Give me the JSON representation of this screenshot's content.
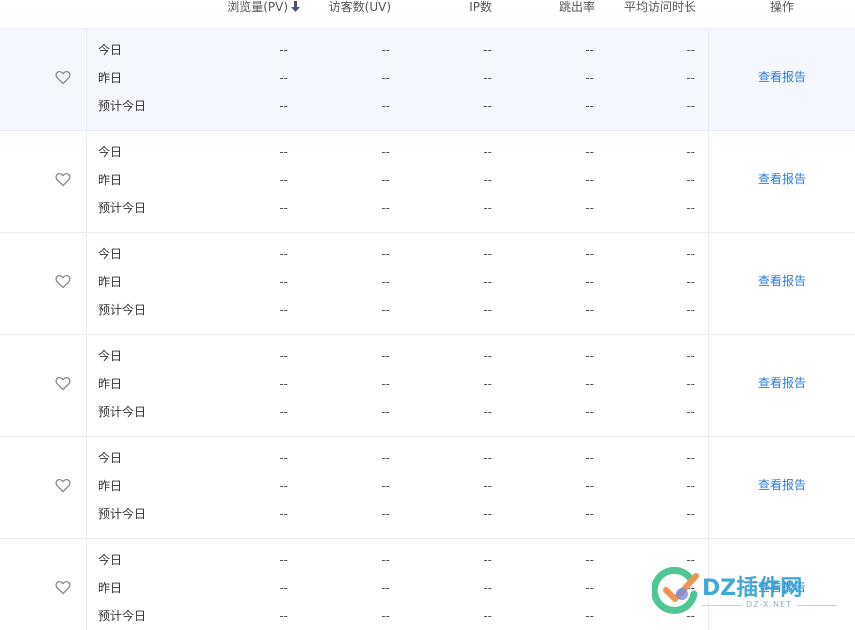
{
  "table": {
    "columns": {
      "pv": "浏览量(PV)",
      "uv": "访客数(UV)",
      "ip": "IP数",
      "bounce": "跳出率",
      "avg_time": "平均访问时长",
      "action": "操作"
    },
    "sort_icon": "arrow-down-icon",
    "row_labels": [
      "今日",
      "昨日",
      "预计今日"
    ],
    "empty_value": "--",
    "action_label": "查看报告",
    "favorite_icon": "heart-outline-icon",
    "groups": [
      {
        "highlighted": true,
        "rows": [
          [
            "--",
            "--",
            "--",
            "--",
            "--"
          ],
          [
            "--",
            "--",
            "--",
            "--",
            "--"
          ],
          [
            "--",
            "--",
            "--",
            "--",
            "--"
          ]
        ]
      },
      {
        "highlighted": false,
        "rows": [
          [
            "--",
            "--",
            "--",
            "--",
            "--"
          ],
          [
            "--",
            "--",
            "--",
            "--",
            "--"
          ],
          [
            "--",
            "--",
            "--",
            "--",
            "--"
          ]
        ]
      },
      {
        "highlighted": false,
        "rows": [
          [
            "--",
            "--",
            "--",
            "--",
            "--"
          ],
          [
            "--",
            "--",
            "--",
            "--",
            "--"
          ],
          [
            "--",
            "--",
            "--",
            "--",
            "--"
          ]
        ]
      },
      {
        "highlighted": false,
        "rows": [
          [
            "--",
            "--",
            "--",
            "--",
            "--"
          ],
          [
            "--",
            "--",
            "--",
            "--",
            "--"
          ],
          [
            "--",
            "--",
            "--",
            "--",
            "--"
          ]
        ]
      },
      {
        "highlighted": false,
        "rows": [
          [
            "--",
            "--",
            "--",
            "--",
            "--"
          ],
          [
            "--",
            "--",
            "--",
            "--",
            "--"
          ],
          [
            "--",
            "--",
            "--",
            "--",
            "--"
          ]
        ]
      },
      {
        "highlighted": false,
        "rows": [
          [
            "--",
            "--",
            "--",
            "--",
            "--"
          ],
          [
            "--",
            "--",
            "--",
            "--",
            "--"
          ],
          [
            "--",
            "--",
            "--",
            "--",
            "--"
          ]
        ]
      }
    ]
  },
  "watermark": {
    "text": "DZ插件网",
    "sub": "DZ-X.NET",
    "icon": "check-logo-icon"
  },
  "colors": {
    "accent_link": "#2b7fd6",
    "highlight_row": "#f4f7fd",
    "border": "#e8ebf0"
  }
}
